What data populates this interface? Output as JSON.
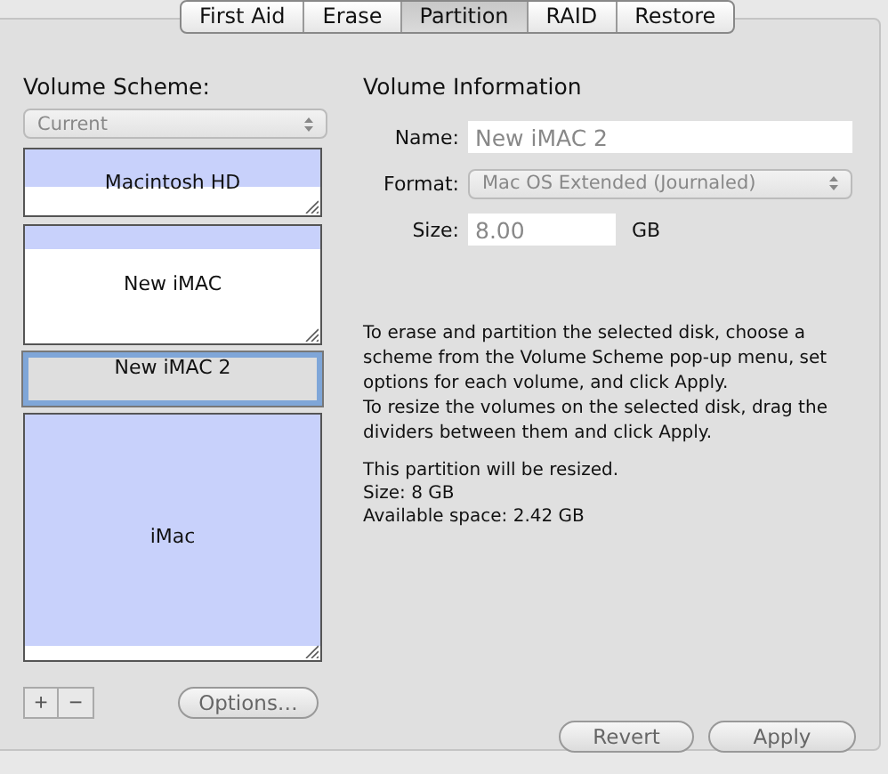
{
  "tabs": [
    {
      "label": "First Aid",
      "selected": false
    },
    {
      "label": "Erase",
      "selected": false
    },
    {
      "label": "Partition",
      "selected": true
    },
    {
      "label": "RAID",
      "selected": false
    },
    {
      "label": "Restore",
      "selected": false
    }
  ],
  "volume_scheme": {
    "heading": "Volume Scheme:",
    "popup": "Current",
    "volumes": [
      {
        "name": "Macintosh HD",
        "selected": false
      },
      {
        "name": "New iMAC",
        "selected": false
      },
      {
        "name": "New iMAC 2",
        "selected": true
      },
      {
        "name": "iMac",
        "selected": false
      }
    ],
    "add_button": "+",
    "remove_button": "−",
    "options_button": "Options…"
  },
  "volume_information": {
    "heading": "Volume Information",
    "name_label": "Name:",
    "name_value": "New iMAC 2",
    "format_label": "Format:",
    "format_value": "Mac OS Extended (Journaled)",
    "size_label": "Size:",
    "size_value": "8.00",
    "size_unit": "GB",
    "instructions": [
      "To erase and partition the selected disk, choose a scheme from the Volume Scheme pop-up menu, set options for each volume, and click Apply.",
      "To resize the volumes on the selected disk, drag the dividers between them and click Apply."
    ],
    "status": [
      "This partition will be resized.",
      "Size: 8 GB",
      "Available space: 2.42 GB"
    ]
  },
  "buttons": [
    "Revert",
    "Apply"
  ]
}
